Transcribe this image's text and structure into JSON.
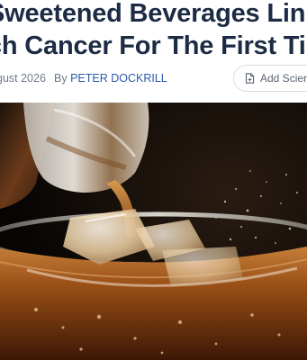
{
  "article": {
    "headline_line1": "Sweetened Beverages Linke",
    "headline_line2": "ch Cancer For The First Time",
    "date": "gust 2026",
    "by_label": "By",
    "author": "PETER DOCKRILL"
  },
  "actions": {
    "add_science_label": "Add Scienc"
  },
  "hero_image": {
    "subject": "soda-pouring-into-glass-with-ice"
  },
  "colors": {
    "headline": "#1d2b44",
    "author_link": "#2b5aa8",
    "meta_text": "#6f7a8a",
    "button_border": "#d9dde3"
  }
}
